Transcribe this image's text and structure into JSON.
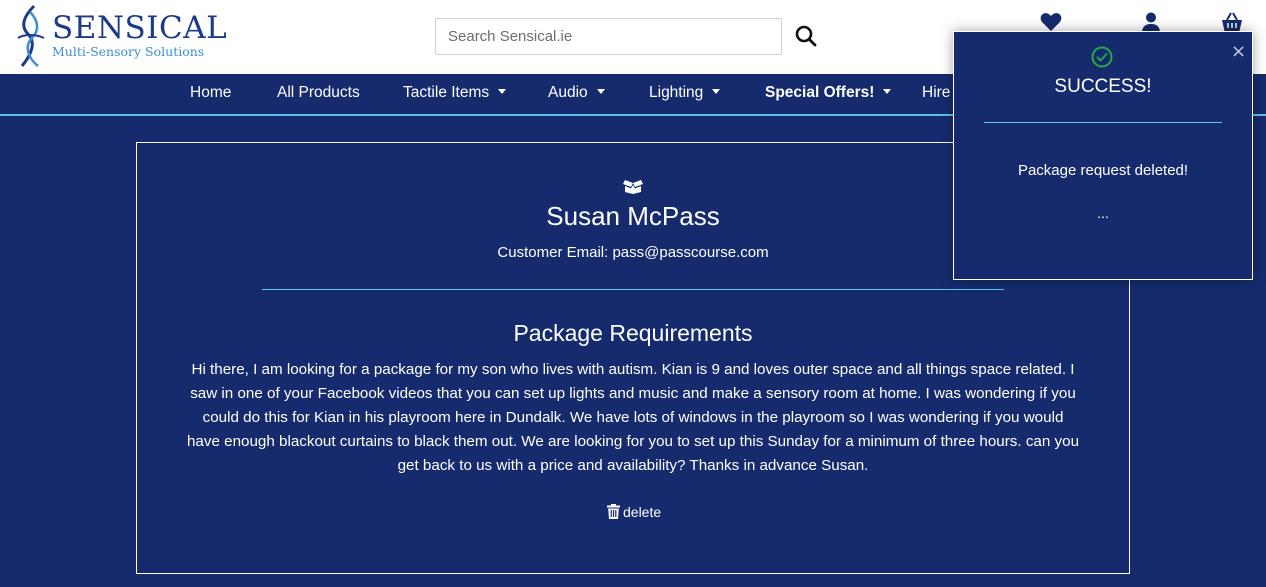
{
  "brand": {
    "name": "SENSICAL",
    "tagline": "Multi-Sensory Solutions"
  },
  "search": {
    "placeholder": "Search Sensical.ie",
    "value": "",
    "icon": "search-icon"
  },
  "header_icons": [
    "heart-icon",
    "user-icon",
    "basket-icon"
  ],
  "nav": {
    "home": "Home",
    "all_products": "All Products",
    "tactile": "Tactile Items",
    "audio": "Audio",
    "lighting": "Lighting",
    "special_offers": "Special Offers!",
    "hire": "Hire"
  },
  "package": {
    "icon": "box-open-icon",
    "customer_name": "Susan McPass",
    "customer_email": "Customer Email: pass@passcourse.com",
    "section_title": "Package Requirements",
    "requirements": "Hi there, I am looking for a package for my son who lives with autism. Kian is 9 and loves outer space and all things space related. I saw in one of your Facebook videos that you can set up lights and music and make a sensory room at home. I was wondering if you could do this for Kian in his playroom here in Dundalk. We have lots of windows in the playroom so I was wondering if you would have enough blackout curtains to black them out. We are looking for you to set up this Sunday for a minimum of three hours. can you get back to us with a price and availability? Thanks in advance Susan.",
    "delete_label": "delete",
    "delete_icon": "trash-icon"
  },
  "toast": {
    "title": "SUCCESS!",
    "message": "Package request deleted!",
    "ellipsis": "...",
    "close_symbol": "×",
    "check_icon": "check-circle-icon"
  },
  "colors": {
    "background": "#152b6e",
    "accent": "#5ec3f0",
    "brand_text": "#1d3a8a",
    "success": "#28a745"
  }
}
